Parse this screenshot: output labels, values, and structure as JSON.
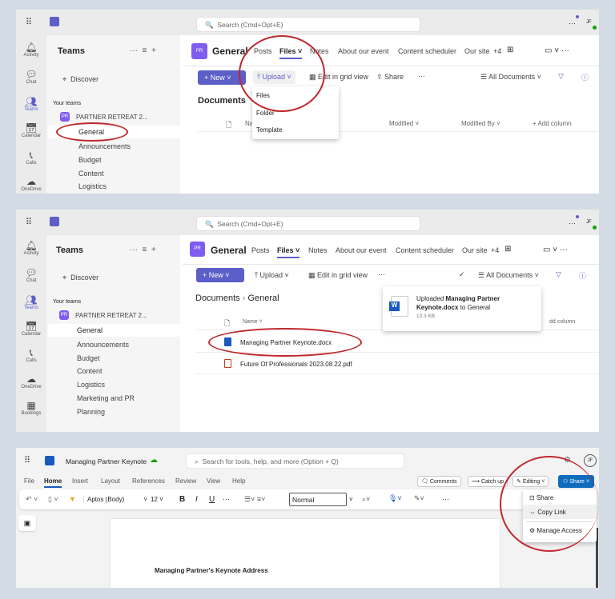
{
  "teams_common": {
    "search_placeholder": "Search (Cmd+Opt+E)",
    "rail": [
      "Activity",
      "Chat",
      "Teams",
      "Calendar",
      "Calls",
      "OneDrive",
      "Bookings"
    ],
    "sidebar_title": "Teams",
    "discover": "Discover",
    "your_teams": "Your teams",
    "team_name": "PARTNER RETREAT 2...",
    "team_initials": "PR",
    "avatar": "JF",
    "channel_title": "General",
    "tabs": [
      "Posts",
      "Files",
      "Notes",
      "About our event",
      "Content scheduler",
      "Our site",
      "+4"
    ],
    "new_label": "New",
    "upload_label": "Upload",
    "grid_label": "Edit in grid view",
    "share_label": "Share",
    "all_documents": "All Documents"
  },
  "panel1": {
    "channels": [
      "General",
      "Announcements",
      "Budget",
      "Content",
      "Logistics"
    ],
    "breadcrumb": "Documents",
    "columns": [
      "Na",
      "Modified",
      "Modified By",
      "+ Add column"
    ],
    "upload_menu": [
      "Files",
      "Folder",
      "Template"
    ]
  },
  "panel2": {
    "channels": [
      "General",
      "Announcements",
      "Budget",
      "Content",
      "Logistics",
      "Marketing and PR",
      "Planning"
    ],
    "breadcrumb": [
      "Documents",
      "General"
    ],
    "columns": [
      "Name",
      "dd column"
    ],
    "files": [
      "Managing Partner Keynote.docx",
      "Future Of Professionals 2023.08.22.pdf"
    ],
    "toast": {
      "prefix": "Uploaded ",
      "bold": "Managing Partner Keynote.docx",
      "suffix": " to General",
      "size": "13.3 KB"
    }
  },
  "panel3": {
    "doc_title": "Managing Partner Keynote",
    "search_placeholder": "Search for tools, help, and more (Option + Q)",
    "menu": [
      "File",
      "Home",
      "Insert",
      "Layout",
      "References",
      "Review",
      "View",
      "Help"
    ],
    "comments": "Comments",
    "catch_up": "Catch up",
    "editing": "Editing",
    "share": "Share",
    "font": "Aptos (Body)",
    "font_size": "12",
    "style": "Normal",
    "share_menu": [
      "Share",
      "Copy Link",
      "Manage Access"
    ],
    "heading": "Managing Partner's Keynote Address",
    "avatar": "JF"
  },
  "colors": {
    "accent": "#5b5fc7",
    "word": "#185abd",
    "annotation": "#c0282d",
    "share": "#0f6cbd"
  }
}
